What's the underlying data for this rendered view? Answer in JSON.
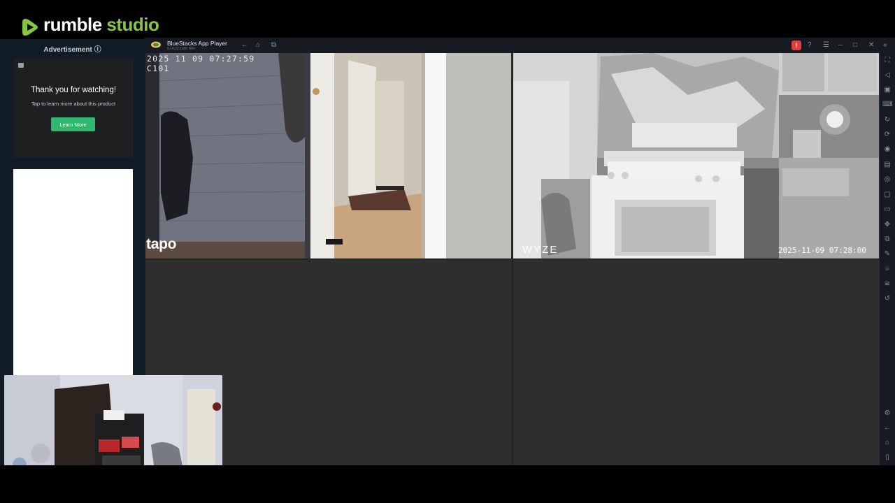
{
  "rumble": {
    "brand_main": "rumble",
    "brand_studio": "studio",
    "accent_color": "#85c742"
  },
  "ad": {
    "header": "Advertisement ⓘ",
    "title": "Thank you for watching!",
    "subtitle": "Tap to learn more about this product",
    "button_label": "Learn More",
    "button_color": "#2fb96f"
  },
  "bluestacks": {
    "title": "BlueStacks App Player",
    "version": "5.14.22.1005 N64",
    "toolbar_icons": [
      "back-icon",
      "home-icon",
      "multi-instance-icon"
    ],
    "window_icons": [
      "alert-icon",
      "help-icon",
      "menu-icon",
      "minimize-icon",
      "maximize-icon",
      "close-icon",
      "collapse-sidebar-icon"
    ],
    "alert_label": "!",
    "sidebar_icons": [
      "fullscreen-icon",
      "volume-icon",
      "screen-record-icon",
      "keyboard-icon",
      "rotate-icon",
      "sync-icon",
      "gamepad-icon",
      "apk-install-icon",
      "screenshot-icon",
      "macro-icon",
      "media-folder-icon",
      "shake-icon",
      "multi-instance-icon",
      "eco-mode-icon",
      "location-icon",
      "layers-icon",
      "refresh-icon",
      "settings-icon",
      "back-icon",
      "home-icon",
      "recent-apps-icon"
    ]
  },
  "cameras": [
    {
      "timestamp": "2025 11 09 07:27:59",
      "camera_id": "C101",
      "brand": "tapo"
    },
    {
      "brand": "WYZE",
      "timestamp": "2025-11-09 07:28:00"
    }
  ]
}
